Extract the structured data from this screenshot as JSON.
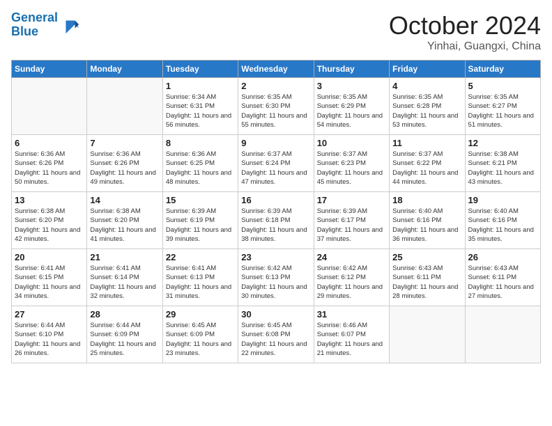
{
  "header": {
    "logo_line1": "General",
    "logo_line2": "Blue",
    "month_title": "October 2024",
    "location": "Yinhai, Guangxi, China"
  },
  "weekdays": [
    "Sunday",
    "Monday",
    "Tuesday",
    "Wednesday",
    "Thursday",
    "Friday",
    "Saturday"
  ],
  "weeks": [
    [
      {
        "day": "",
        "empty": true
      },
      {
        "day": "",
        "empty": true
      },
      {
        "day": "1",
        "sunrise": "6:34 AM",
        "sunset": "6:31 PM",
        "daylight": "Daylight: 11 hours and 56 minutes."
      },
      {
        "day": "2",
        "sunrise": "6:35 AM",
        "sunset": "6:30 PM",
        "daylight": "Daylight: 11 hours and 55 minutes."
      },
      {
        "day": "3",
        "sunrise": "6:35 AM",
        "sunset": "6:29 PM",
        "daylight": "Daylight: 11 hours and 54 minutes."
      },
      {
        "day": "4",
        "sunrise": "6:35 AM",
        "sunset": "6:28 PM",
        "daylight": "Daylight: 11 hours and 53 minutes."
      },
      {
        "day": "5",
        "sunrise": "6:35 AM",
        "sunset": "6:27 PM",
        "daylight": "Daylight: 11 hours and 51 minutes."
      }
    ],
    [
      {
        "day": "6",
        "sunrise": "6:36 AM",
        "sunset": "6:26 PM",
        "daylight": "Daylight: 11 hours and 50 minutes."
      },
      {
        "day": "7",
        "sunrise": "6:36 AM",
        "sunset": "6:26 PM",
        "daylight": "Daylight: 11 hours and 49 minutes."
      },
      {
        "day": "8",
        "sunrise": "6:36 AM",
        "sunset": "6:25 PM",
        "daylight": "Daylight: 11 hours and 48 minutes."
      },
      {
        "day": "9",
        "sunrise": "6:37 AM",
        "sunset": "6:24 PM",
        "daylight": "Daylight: 11 hours and 47 minutes."
      },
      {
        "day": "10",
        "sunrise": "6:37 AM",
        "sunset": "6:23 PM",
        "daylight": "Daylight: 11 hours and 45 minutes."
      },
      {
        "day": "11",
        "sunrise": "6:37 AM",
        "sunset": "6:22 PM",
        "daylight": "Daylight: 11 hours and 44 minutes."
      },
      {
        "day": "12",
        "sunrise": "6:38 AM",
        "sunset": "6:21 PM",
        "daylight": "Daylight: 11 hours and 43 minutes."
      }
    ],
    [
      {
        "day": "13",
        "sunrise": "6:38 AM",
        "sunset": "6:20 PM",
        "daylight": "Daylight: 11 hours and 42 minutes."
      },
      {
        "day": "14",
        "sunrise": "6:38 AM",
        "sunset": "6:20 PM",
        "daylight": "Daylight: 11 hours and 41 minutes."
      },
      {
        "day": "15",
        "sunrise": "6:39 AM",
        "sunset": "6:19 PM",
        "daylight": "Daylight: 11 hours and 39 minutes."
      },
      {
        "day": "16",
        "sunrise": "6:39 AM",
        "sunset": "6:18 PM",
        "daylight": "Daylight: 11 hours and 38 minutes."
      },
      {
        "day": "17",
        "sunrise": "6:39 AM",
        "sunset": "6:17 PM",
        "daylight": "Daylight: 11 hours and 37 minutes."
      },
      {
        "day": "18",
        "sunrise": "6:40 AM",
        "sunset": "6:16 PM",
        "daylight": "Daylight: 11 hours and 36 minutes."
      },
      {
        "day": "19",
        "sunrise": "6:40 AM",
        "sunset": "6:16 PM",
        "daylight": "Daylight: 11 hours and 35 minutes."
      }
    ],
    [
      {
        "day": "20",
        "sunrise": "6:41 AM",
        "sunset": "6:15 PM",
        "daylight": "Daylight: 11 hours and 34 minutes."
      },
      {
        "day": "21",
        "sunrise": "6:41 AM",
        "sunset": "6:14 PM",
        "daylight": "Daylight: 11 hours and 32 minutes."
      },
      {
        "day": "22",
        "sunrise": "6:41 AM",
        "sunset": "6:13 PM",
        "daylight": "Daylight: 11 hours and 31 minutes."
      },
      {
        "day": "23",
        "sunrise": "6:42 AM",
        "sunset": "6:13 PM",
        "daylight": "Daylight: 11 hours and 30 minutes."
      },
      {
        "day": "24",
        "sunrise": "6:42 AM",
        "sunset": "6:12 PM",
        "daylight": "Daylight: 11 hours and 29 minutes."
      },
      {
        "day": "25",
        "sunrise": "6:43 AM",
        "sunset": "6:11 PM",
        "daylight": "Daylight: 11 hours and 28 minutes."
      },
      {
        "day": "26",
        "sunrise": "6:43 AM",
        "sunset": "6:11 PM",
        "daylight": "Daylight: 11 hours and 27 minutes."
      }
    ],
    [
      {
        "day": "27",
        "sunrise": "6:44 AM",
        "sunset": "6:10 PM",
        "daylight": "Daylight: 11 hours and 26 minutes."
      },
      {
        "day": "28",
        "sunrise": "6:44 AM",
        "sunset": "6:09 PM",
        "daylight": "Daylight: 11 hours and 25 minutes."
      },
      {
        "day": "29",
        "sunrise": "6:45 AM",
        "sunset": "6:09 PM",
        "daylight": "Daylight: 11 hours and 23 minutes."
      },
      {
        "day": "30",
        "sunrise": "6:45 AM",
        "sunset": "6:08 PM",
        "daylight": "Daylight: 11 hours and 22 minutes."
      },
      {
        "day": "31",
        "sunrise": "6:46 AM",
        "sunset": "6:07 PM",
        "daylight": "Daylight: 11 hours and 21 minutes."
      },
      {
        "day": "",
        "empty": true
      },
      {
        "day": "",
        "empty": true
      }
    ]
  ]
}
